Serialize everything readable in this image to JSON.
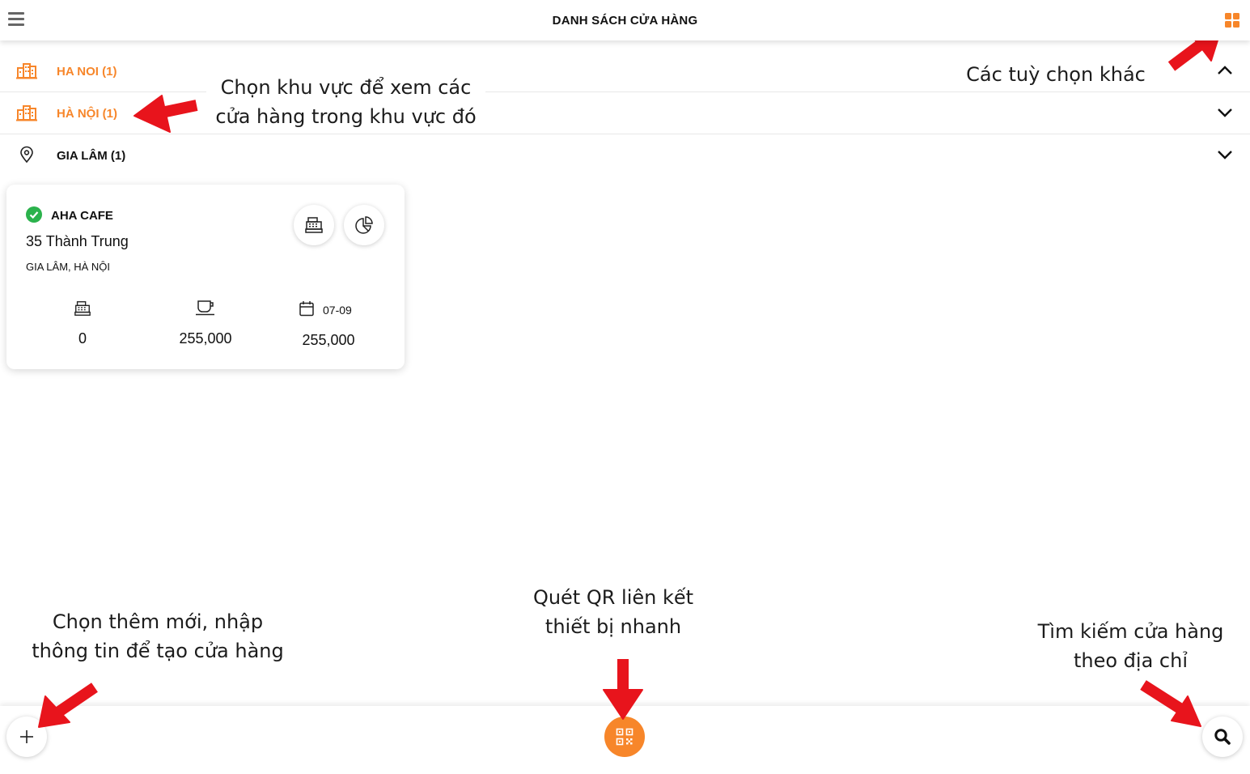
{
  "header": {
    "title": "DANH SÁCH CỬA HÀNG"
  },
  "regions": [
    {
      "label": "HA NOI (1)",
      "color": "#f7862a",
      "icon": "city-icon",
      "expanded": true
    },
    {
      "label": "HÀ NỘI (1)",
      "color": "#f7862a",
      "icon": "city-icon",
      "expanded": false
    },
    {
      "label": "GIA LÂM (1)",
      "color": "#111111",
      "icon": "location-pin-icon",
      "expanded": false
    }
  ],
  "store": {
    "name": "AHA CAFE",
    "address": "35 Thành Trung",
    "area": "GIA LÂM, HÀ NỘI",
    "stats": {
      "cash_register": "0",
      "drinks": "255,000",
      "date_label": "07-09",
      "date_value": "255,000"
    }
  },
  "annotations": {
    "region_note_line1": "Chọn khu vực để xem các",
    "region_note_line2": "cửa hàng trong khu vực đó",
    "options_note": "Các tuỳ chọn khác",
    "add_note_line1": "Chọn thêm mới, nhập",
    "add_note_line2": "thông tin để tạo cửa hàng",
    "qr_note_line1": "Quét QR liên kết",
    "qr_note_line2": "thiết bị nhanh",
    "search_note_line1": "Tìm kiếm cửa hàng",
    "search_note_line2": "theo địa chỉ"
  },
  "colors": {
    "accent": "#f7862a",
    "success": "#2bb24c",
    "annotation_arrow": "#e8141c"
  }
}
